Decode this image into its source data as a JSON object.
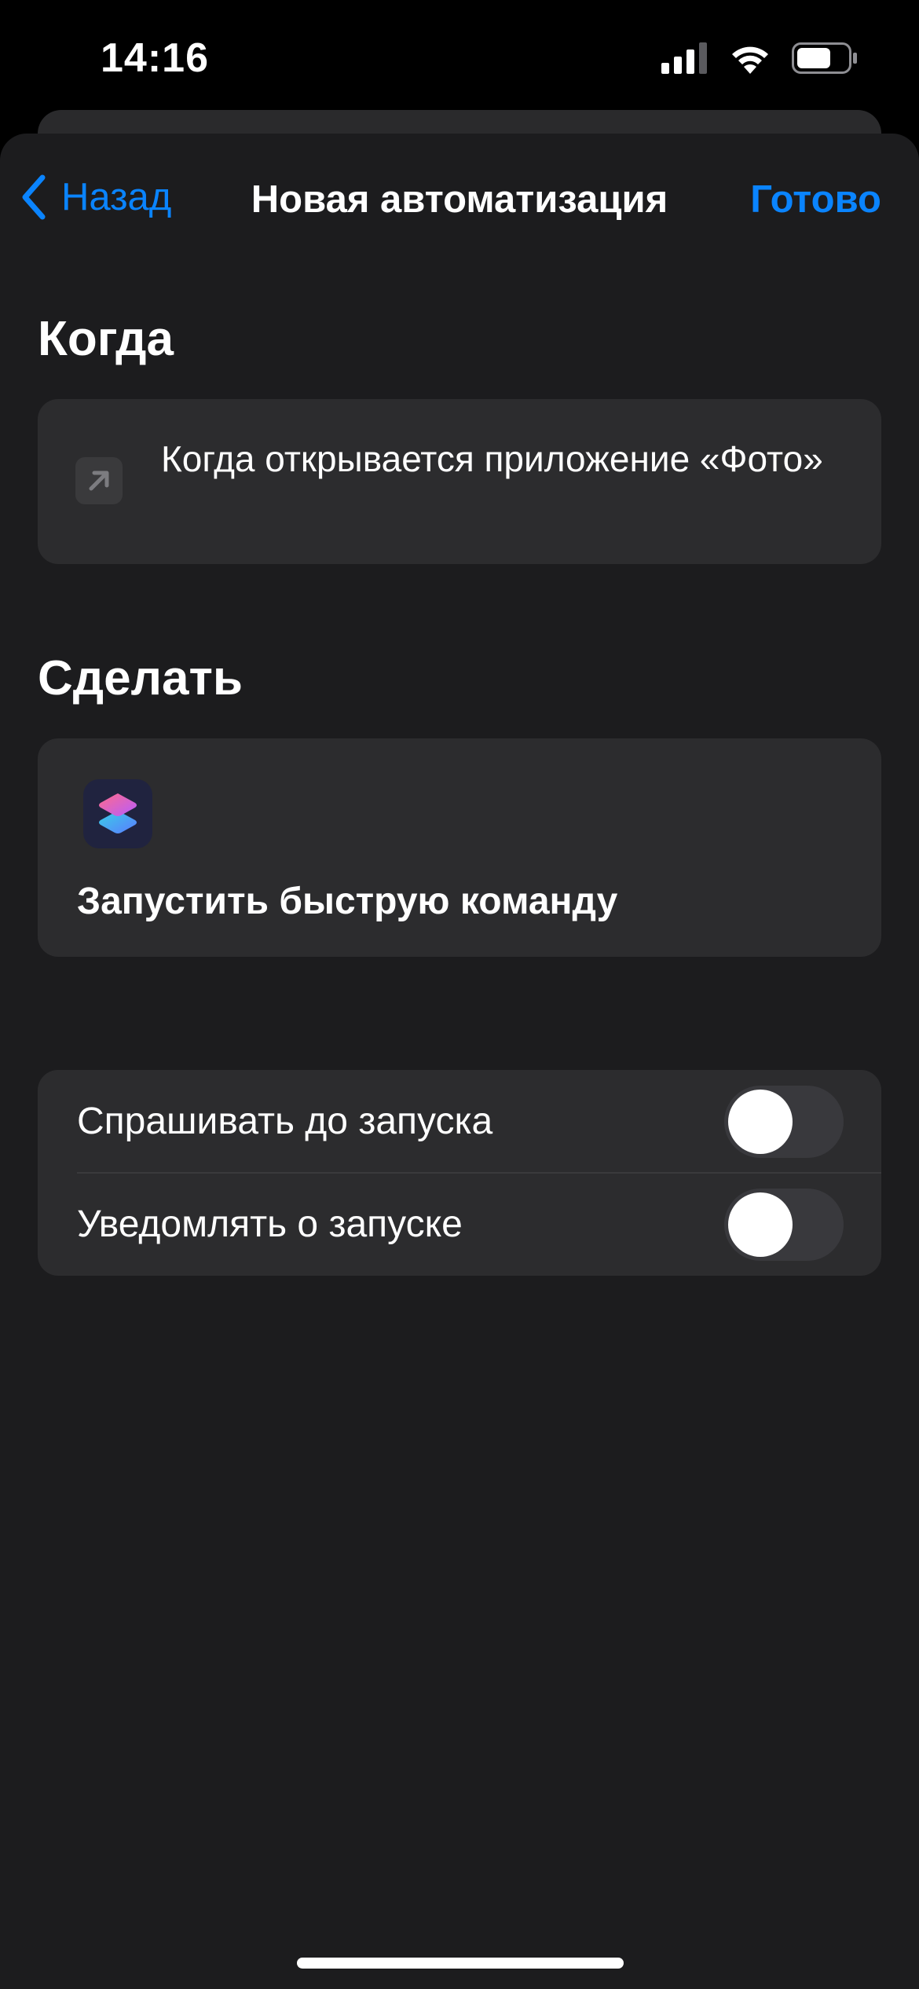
{
  "status_bar": {
    "time": "14:16"
  },
  "nav": {
    "back_label": "Назад",
    "title": "Новая автоматизация",
    "done_label": "Готово"
  },
  "when_section": {
    "header": "Когда",
    "trigger_text": "Когда открывается приложение «Фото»",
    "trigger_icon": "arrow-up-right-icon"
  },
  "do_section": {
    "header": "Сделать",
    "action_label": "Запустить быструю команду",
    "action_icon": "shortcuts-app-icon"
  },
  "options": {
    "ask_before_running": {
      "label": "Спрашивать до запуска",
      "enabled": false
    },
    "notify_when_run": {
      "label": "Уведомлять о запуске",
      "enabled": false
    }
  },
  "colors": {
    "accent": "#0a84ff",
    "background": "#1c1c1e",
    "card": "#2c2c2e"
  }
}
